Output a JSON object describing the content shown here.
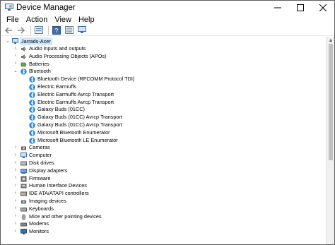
{
  "window": {
    "title": "Device Manager"
  },
  "menu": [
    "File",
    "Action",
    "View",
    "Help"
  ],
  "toolbar_icons": [
    "back-arrow-icon",
    "forward-arrow-icon",
    "properties-icon",
    "help-icon",
    "device-list-icon",
    "monitor-icon"
  ],
  "tree": {
    "root": "Jarrads-Acer",
    "categories": [
      {
        "label": "Audio inputs and outputs",
        "icon": "speaker-icon",
        "expanded": false
      },
      {
        "label": "Audio Processing Objects (APOs)",
        "icon": "speaker-icon",
        "expanded": false
      },
      {
        "label": "Batteries",
        "icon": "battery-icon",
        "expanded": false
      },
      {
        "label": "Bluetooth",
        "icon": "bluetooth-icon",
        "expanded": true,
        "children": [
          "Bluetooth Device (RFCOMM Protocol TDI)",
          "Electric Earmuffs",
          "Electric Earmuffs Avrcp Transport",
          "Electric Earmuffs Avrcp Transport",
          "Galaxy Buds (01CC)",
          "Galaxy Buds (01CC) Avrcp Transport",
          "Galaxy Buds (01CC) Avrcp Transport",
          "Microsoft Bluetooth Enumerator",
          "Microsoft Bluetooth LE Enumerator"
        ]
      },
      {
        "label": "Cameras",
        "icon": "camera-icon",
        "expanded": false
      },
      {
        "label": "Computer",
        "icon": "computer-icon",
        "expanded": false
      },
      {
        "label": "Disk drives",
        "icon": "disk-icon",
        "expanded": false
      },
      {
        "label": "Display adapters",
        "icon": "display-adapter-icon",
        "expanded": false
      },
      {
        "label": "Firmware",
        "icon": "firmware-icon",
        "expanded": false
      },
      {
        "label": "Human Interface Devices",
        "icon": "hid-icon",
        "expanded": false
      },
      {
        "label": "IDE ATA/ATAPI controllers",
        "icon": "ide-icon",
        "expanded": false
      },
      {
        "label": "Imaging devices",
        "icon": "imaging-icon",
        "expanded": false
      },
      {
        "label": "Keyboards",
        "icon": "keyboard-icon",
        "expanded": false
      },
      {
        "label": "Mice and other pointing devices",
        "icon": "mouse-icon",
        "expanded": false
      },
      {
        "label": "Modems",
        "icon": "modem-icon",
        "expanded": false
      },
      {
        "label": "Monitors",
        "icon": "monitor-icon",
        "expanded": false
      }
    ]
  },
  "colors": {
    "selection": "#cde8ff",
    "bluetooth": "#1e88e5"
  }
}
